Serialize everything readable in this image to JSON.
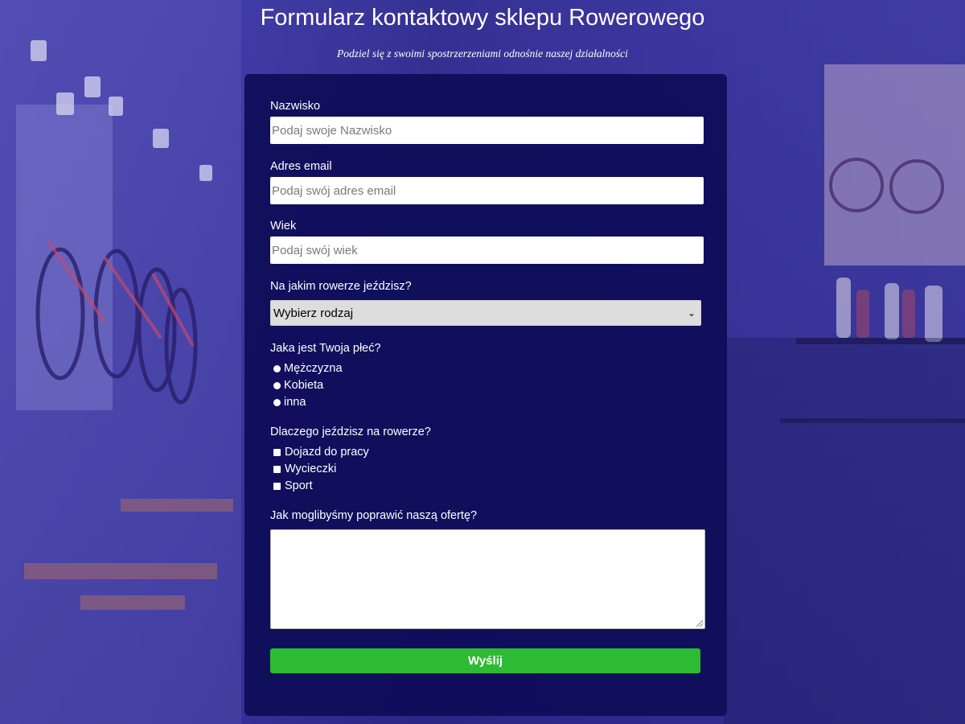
{
  "header": {
    "title": "Formularz kontaktowy sklepu Rowerowego",
    "subtitle": "Podziel się z swoimi spostrzerzeniami odnośnie naszej działalności"
  },
  "form": {
    "surname": {
      "label": "Nazwisko",
      "placeholder": "Podaj swoje Nazwisko",
      "value": ""
    },
    "email": {
      "label": "Adres email",
      "placeholder": "Podaj swój adres email",
      "value": ""
    },
    "age": {
      "label": "Wiek",
      "placeholder": "Podaj swój wiek",
      "value": ""
    },
    "bike_type": {
      "label": "Na jakim rowerze jeździsz?",
      "selected": "Wybierz rodzaj"
    },
    "gender": {
      "label": "Jaka jest Twoja płeć?",
      "options": [
        "Mężczyzna",
        "Kobieta",
        "inna"
      ]
    },
    "reasons": {
      "label": "Dlaczego jeździsz na rowerze?",
      "options": [
        "Dojazd do pracy",
        "Wycieczki",
        "Sport"
      ]
    },
    "improvement": {
      "label": "Jak moglibyśmy poprawić naszą ofertę?",
      "value": ""
    },
    "submit_label": "Wyślij"
  },
  "colors": {
    "card_bg": "#0e0d58",
    "submit_bg": "#2dbb33",
    "page_tint": "#3f3f9a"
  }
}
